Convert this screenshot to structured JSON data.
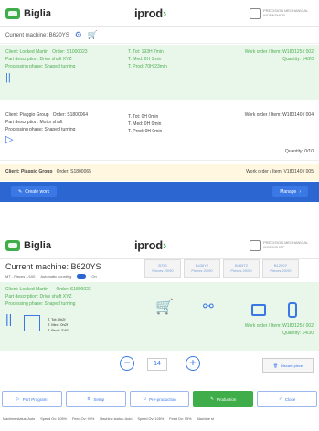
{
  "app": {
    "brand": "Biglia",
    "product_main": "iprod",
    "brand_right": "PRECISION MECHANICAL WORKSHOP"
  },
  "top": {
    "current_machine": "Current machine: B620YS",
    "cards": [
      {
        "client": "Client: Locked Martin",
        "order": "Order: S1000023",
        "part": "Part description: Drive shaft XYZ",
        "phase": "Processing phase: Shaped turning",
        "t_tot": "T. Tot: 193H 7min",
        "t_med": "T. Med: 0H 1min",
        "t_prod": "T. Prod: 70H 23min",
        "wo": "Work order / Item: W180125 / 002",
        "qty": "Quantity: 14/20"
      },
      {
        "client": "Client: Piaggio Group",
        "order": "Order: S1800064",
        "part": "Part description: Motor shaft",
        "phase": "Processing phase: Shaped turning",
        "t_tot": "T. Tot: 0H 0min",
        "t_med": "T. Med: 0H 0min",
        "t_prod": "T. Prod: 0H 0min",
        "wo": "Work order / Item: W180140 / 004",
        "qty": "Quantity: 0/10"
      },
      {
        "client": "Client: Piaggio Group",
        "order": "Order: S1800065",
        "wo": "Work order / Item: V180140 / 005"
      }
    ],
    "create_label": "Create work",
    "manage_label": "Manage"
  },
  "bottom": {
    "current_machine": "Current machine: B620YS",
    "sub": "MT - Pieces 1/100",
    "counting": "Automatic counting",
    "toggle": "On",
    "machines": [
      {
        "code": "B750",
        "pieces": "Pieces 20/90"
      },
      {
        "code": "B436Y2",
        "pieces": "Pieces 20/90"
      },
      {
        "code": "B465T2",
        "pieces": "Pieces 20/90"
      },
      {
        "code": "B1250Y",
        "pieces": "Pieces 20/90"
      }
    ],
    "client": "Client: Locked Martin",
    "order": "Order: S1800023",
    "part": "Part description: Drive shaft XYZ",
    "phase": "Processing phase: Shaped turning",
    "t_tot": "T. Tot: 0h2f",
    "t_med": "T. Med: 0h2f",
    "t_prod": "T. Prod: 3'40\"",
    "wo": "Work order / Item: W180125 / 002",
    "qty": "Quantity: 14/30",
    "counter": "14",
    "discard": "Discard piece",
    "tabs": [
      "Part Program",
      "Setup",
      "Pre-production",
      "Production",
      "Close"
    ],
    "status_items": [
      "Machine status: Auto",
      "Speed Ov: 105%",
      "Feed Ov: 95%",
      "Machine status: Auto",
      "Speed Ov: 105%",
      "Feed Ov: 95%",
      "Machine st"
    ]
  }
}
